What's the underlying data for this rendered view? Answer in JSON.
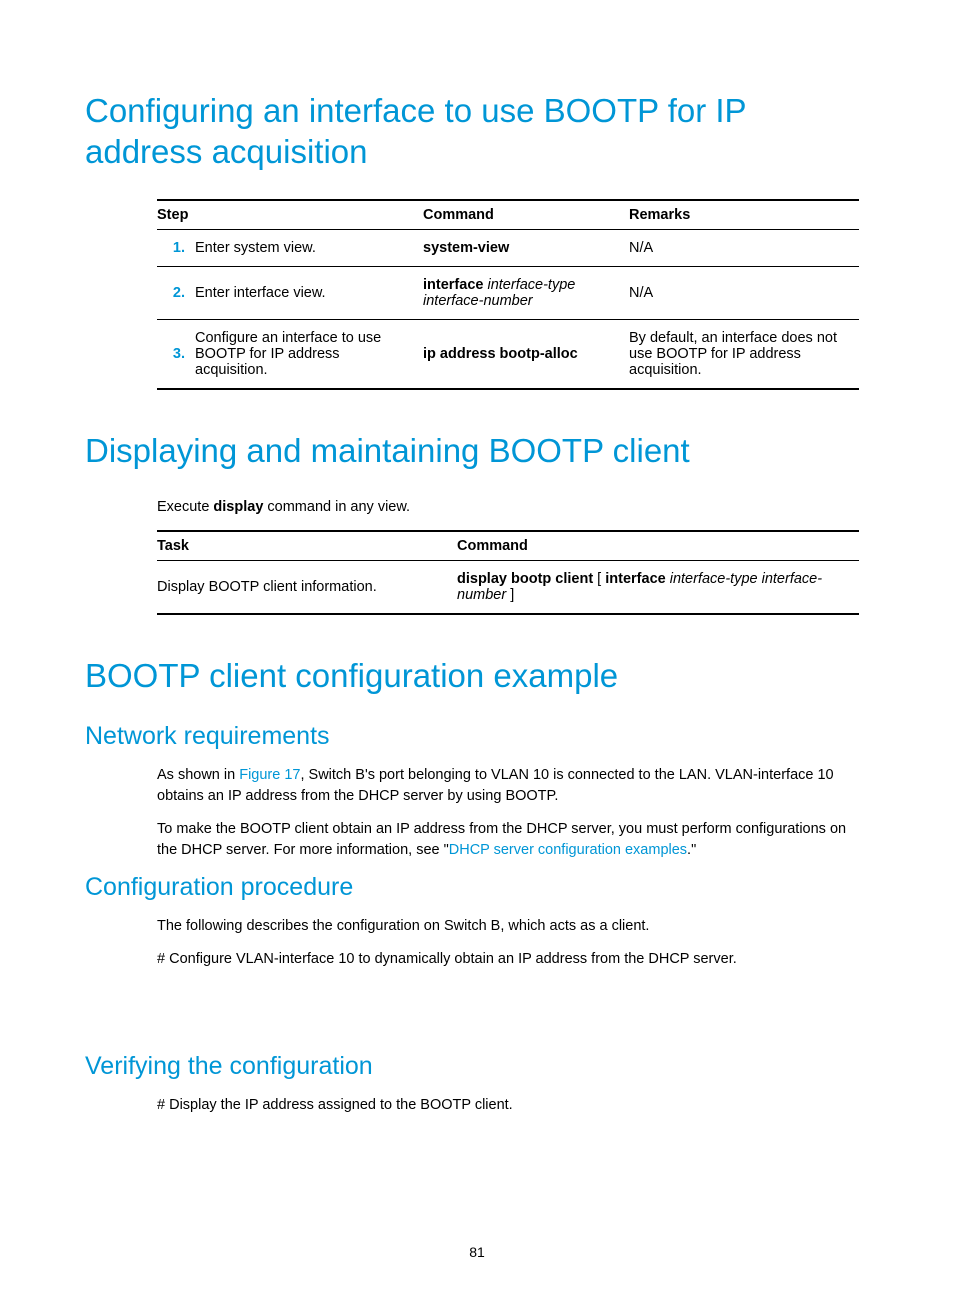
{
  "heading1": "Configuring an interface to use BOOTP for IP address acquisition",
  "table1": {
    "headers": {
      "step": "Step",
      "command": "Command",
      "remarks": "Remarks"
    },
    "rows": [
      {
        "num": "1.",
        "step": "Enter system view.",
        "cmd_bold": "system-view",
        "cmd_ital": "",
        "remarks": "N/A"
      },
      {
        "num": "2.",
        "step": "Enter interface view.",
        "cmd_bold": "interface",
        "cmd_ital": " interface-type interface-number",
        "remarks": "N/A"
      },
      {
        "num": "3.",
        "step": "Configure an interface to use BOOTP for IP address acquisition.",
        "cmd_bold": "ip address bootp-alloc",
        "cmd_ital": "",
        "remarks": "By default, an interface does not use BOOTP for IP address acquisition."
      }
    ]
  },
  "heading2": "Displaying and maintaining BOOTP client",
  "para2_a": "Execute ",
  "para2_b": "display",
  "para2_c": " command in any view.",
  "table2": {
    "headers": {
      "task": "Task",
      "command": "Command"
    },
    "row": {
      "task": "Display BOOTP client information.",
      "cmd_b1": "display bootp client",
      "cmd_p1": " [ ",
      "cmd_b2": "interface",
      "cmd_i1": " interface-type interface-number",
      "cmd_p2": " ]"
    }
  },
  "heading3": "BOOTP client configuration example",
  "sub1": "Network requirements",
  "p1_a": "As shown in ",
  "p1_link1": "Figure 17",
  "p1_b": ", Switch B's port belonging to VLAN 10 is connected to the LAN. VLAN-interface 10 obtains an IP address from the DHCP server by using BOOTP.",
  "p2_a": "To make the BOOTP client obtain an IP address from the DHCP server, you must perform configurations on the DHCP server. For more information, see \"",
  "p2_link": "DHCP server configuration examples",
  "p2_b": ".\"",
  "sub2": "Configuration procedure",
  "p3": "The following describes the configuration on Switch B, which acts as a client.",
  "p4": "# Configure VLAN-interface 10 to dynamically obtain an IP address from the DHCP server.",
  "sub3": "Verifying the configuration",
  "p5": "# Display the IP address assigned to the BOOTP client.",
  "pagenum": "81"
}
